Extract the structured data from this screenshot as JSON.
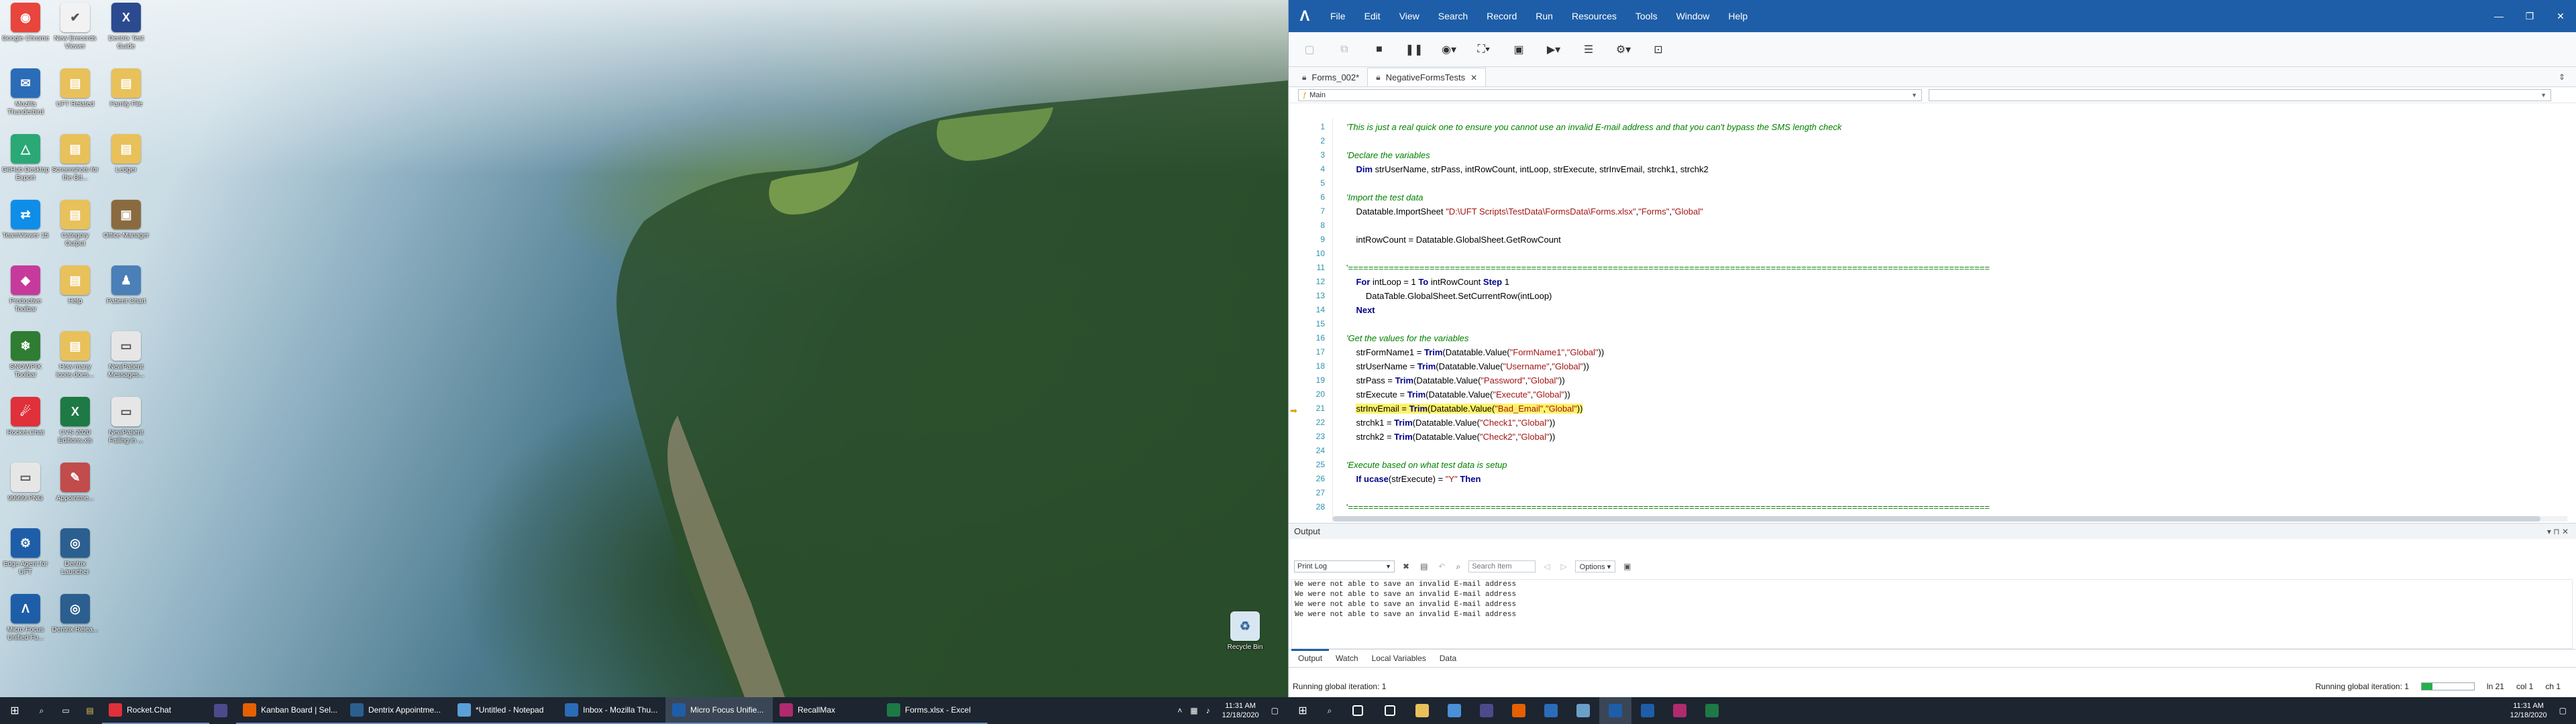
{
  "desktop": {
    "icons_col1": [
      {
        "label": "Google Chrome",
        "color": "#e8453c",
        "glyph": "◉",
        "icon": "chrome-icon"
      },
      {
        "label": "Mozilla Thunderbird",
        "color": "#2b6cb8",
        "glyph": "✉",
        "icon": "thunderbird-icon"
      },
      {
        "label": "GitHub Desktop Export",
        "color": "#2aa876",
        "glyph": "△",
        "icon": "triangle-app-icon"
      },
      {
        "label": "TeamViewer 15",
        "color": "#0e8ee9",
        "glyph": "⇄",
        "icon": "teamviewer-icon"
      },
      {
        "label": "Productive Toolbar",
        "color": "#c63a9b",
        "glyph": "◆",
        "icon": "productive-icon"
      },
      {
        "label": "SNOWPIX Toolbar",
        "color": "#2e7d32",
        "glyph": "❄",
        "icon": "snowpix-icon"
      },
      {
        "label": "Rocket.Chat",
        "color": "#e0303a",
        "glyph": "☄",
        "icon": "rocketchat-icon"
      },
      {
        "label": "99999.PNG",
        "color": "#e6e6e6",
        "glyph": "▭",
        "icon": "png-file-icon"
      },
      {
        "label": "Edge Agent for UFT",
        "color": "#1e5ea8",
        "glyph": "⚙",
        "icon": "edge-agent-icon"
      },
      {
        "label": "Micro Focus Unified Fu...",
        "color": "#1e5ea8",
        "glyph": "Λ",
        "icon": "uft-icon"
      }
    ],
    "icons_col2": [
      {
        "label": "New Erecords Viewer",
        "color": "#f2f2f2",
        "glyph": "✔",
        "icon": "checklist-icon"
      },
      {
        "label": "UFT Related",
        "color": "#e8c15a",
        "glyph": "▤",
        "icon": "folder-icon"
      },
      {
        "label": "Screenshots for the Bd...",
        "color": "#e8c15a",
        "glyph": "▤",
        "icon": "folder-icon"
      },
      {
        "label": "Category Output",
        "color": "#e8c15a",
        "glyph": "▤",
        "icon": "folder-icon"
      },
      {
        "label": "Help",
        "color": "#e8c15a",
        "glyph": "▤",
        "icon": "folder-icon"
      },
      {
        "label": "How many icons does...",
        "color": "#e8c15a",
        "glyph": "▤",
        "icon": "folder-icon"
      },
      {
        "label": "CVS 2020 Editions.xls",
        "color": "#1d7a44",
        "glyph": "X",
        "icon": "excel-file-icon"
      },
      {
        "label": "Appointme...",
        "color": "#c24b4b",
        "glyph": "✎",
        "icon": "appointment-icon"
      },
      {
        "label": "Dentrix Launcher",
        "color": "#2b5f8f",
        "glyph": "◎",
        "icon": "dentrix-launcher-icon"
      },
      {
        "label": "Dentrix Relea...",
        "color": "#2b5f8f",
        "glyph": "◎",
        "icon": "dentrix-release-icon"
      }
    ],
    "icons_col3": [
      {
        "label": "Dentrix Test Guide",
        "color": "#2b4a8f",
        "glyph": "X",
        "icon": "dentrix-x-icon"
      },
      {
        "label": "Family File",
        "color": "#e8c15a",
        "glyph": "▤",
        "icon": "folder-icon"
      },
      {
        "label": "Ledger",
        "color": "#e8c15a",
        "glyph": "▤",
        "icon": "folder-icon"
      },
      {
        "label": "Office Manager",
        "color": "#8a6b3f",
        "glyph": "▣",
        "icon": "office-manager-icon"
      },
      {
        "label": "Patient Chart",
        "color": "#4a7fb8",
        "glyph": "♟",
        "icon": "patient-chart-icon"
      },
      {
        "label": "NewPatient Messages...",
        "color": "#e6e6e6",
        "glyph": "▭",
        "icon": "file-icon"
      },
      {
        "label": "NewPatient Failing in ...",
        "color": "#e6e6e6",
        "glyph": "▭",
        "icon": "file-icon"
      }
    ],
    "recycle_bin": {
      "label": "Recycle Bin",
      "color": "#d8e6f2",
      "glyph": "♻",
      "icon": "recycle-bin-icon"
    }
  },
  "taskbar_left": {
    "start_icon": "windows-start-icon",
    "apps": [
      {
        "label": "Rocket.Chat",
        "color": "#e0303a"
      },
      {
        "label": "",
        "color": "#4d4a8c"
      },
      {
        "label": "Kanban Board | Sel...",
        "color": "#e66000"
      },
      {
        "label": "Dentrix Appointme...",
        "color": "#2b5f8f"
      },
      {
        "label": "*Untitled - Notepad",
        "color": "#5aa0d8"
      },
      {
        "label": "Inbox - Mozilla Thu...",
        "color": "#2b6cb8"
      },
      {
        "label": "Micro Focus Unifie...",
        "color": "#1e5ea8"
      },
      {
        "label": "RecallMax",
        "color": "#b02a6e"
      },
      {
        "label": "Forms.xlsx - Excel",
        "color": "#1d7a44"
      }
    ],
    "clock_time": "11:31 AM",
    "clock_date": "12/18/2020"
  },
  "taskbar_right": {
    "clock_time": "11:31 AM",
    "clock_date": "12/18/2020",
    "pinned_colors": [
      "#ffffff",
      "#ffffff",
      "#e8c15a",
      "#4a8fd8",
      "#4d4a8c",
      "#e66000",
      "#2b6cb8",
      "#6aa0c8",
      "#1e5ea8",
      "#1e5ea8",
      "#b02a6e",
      "#1d7a44"
    ]
  },
  "uft": {
    "menu": [
      "File",
      "Edit",
      "View",
      "Search",
      "Record",
      "Run",
      "Resources",
      "Tools",
      "Window",
      "Help"
    ],
    "tabs": [
      {
        "label": "Forms_002*",
        "active": false
      },
      {
        "label": "NegativeFormsTests",
        "active": true
      }
    ],
    "scope_main": "Main",
    "code_lines": [
      {
        "n": "1",
        "type": "comment",
        "text": "'This is just a real quick one to ensure you cannot use an invalid E-mail address and that you can't bypass the SMS length check"
      },
      {
        "n": "2",
        "type": "blank",
        "text": ""
      },
      {
        "n": "3",
        "type": "comment",
        "text": "'Declare the variables"
      },
      {
        "n": "4",
        "type": "code",
        "text": "    Dim strUserName, strPass, intRowCount, intLoop, strExecute, strInvEmail, strchk1, strchk2"
      },
      {
        "n": "5",
        "type": "blank",
        "text": ""
      },
      {
        "n": "6",
        "type": "comment",
        "text": "'Import the test data"
      },
      {
        "n": "7",
        "type": "code",
        "text": "    Datatable.ImportSheet \"D:\\UFT Scripts\\TestData\\FormsData\\Forms.xlsx\",\"Forms\",\"Global\""
      },
      {
        "n": "8",
        "type": "blank",
        "text": ""
      },
      {
        "n": "9",
        "type": "code",
        "text": "    intRowCount = Datatable.GlobalSheet.GetRowCount"
      },
      {
        "n": "10",
        "type": "blank",
        "text": ""
      },
      {
        "n": "11",
        "type": "sep",
        "text": "'=============================================================================================================================="
      },
      {
        "n": "12",
        "type": "code",
        "text": "    For intLoop = 1 To intRowCount Step 1"
      },
      {
        "n": "13",
        "type": "code",
        "text": "        DataTable.GlobalSheet.SetCurrentRow(intLoop)"
      },
      {
        "n": "14",
        "type": "code",
        "text": "    Next"
      },
      {
        "n": "15",
        "type": "blank",
        "text": ""
      },
      {
        "n": "16",
        "type": "comment",
        "text": "'Get the values for the variables"
      },
      {
        "n": "17",
        "type": "code",
        "text": "    strFormName1 = Trim(Datatable.Value(\"FormName1\",\"Global\"))"
      },
      {
        "n": "18",
        "type": "code",
        "text": "    strUserName = Trim(Datatable.Value(\"Username\",\"Global\"))"
      },
      {
        "n": "19",
        "type": "code",
        "text": "    strPass = Trim(Datatable.Value(\"Password\",\"Global\"))"
      },
      {
        "n": "20",
        "type": "code",
        "text": "    strExecute = Trim(Datatable.Value(\"Execute\",\"Global\"))"
      },
      {
        "n": "21",
        "type": "current",
        "text": "    strInvEmail = Trim(Datatable.Value(\"Bad_Email\",\"Global\"))"
      },
      {
        "n": "22",
        "type": "code",
        "text": "    strchk1 = Trim(Datatable.Value(\"Check1\",\"Global\"))"
      },
      {
        "n": "23",
        "type": "code",
        "text": "    strchk2 = Trim(Datatable.Value(\"Check2\",\"Global\"))"
      },
      {
        "n": "24",
        "type": "blank",
        "text": ""
      },
      {
        "n": "25",
        "type": "comment",
        "text": "'Execute based on what test data is setup"
      },
      {
        "n": "26",
        "type": "code",
        "text": "    If ucase(strExecute) = \"Y\" Then"
      },
      {
        "n": "27",
        "type": "blank",
        "text": ""
      },
      {
        "n": "28",
        "type": "sep",
        "text": "'=============================================================================================================================="
      }
    ],
    "output": {
      "pane_title": "Output",
      "filter": "Print Log",
      "search_placeholder": "Search Item",
      "options_label": "Options",
      "lines": [
        "We were not able to save an invalid E-mail address",
        "We were not able to save an invalid E-mail address",
        "We were not able to save an invalid E-mail address",
        "We were not able to save an invalid E-mail address"
      ]
    },
    "bottom_tabs": [
      "Output",
      "Watch",
      "Local Variables",
      "Data"
    ],
    "status": {
      "left": "Running global iteration: 1",
      "right": "Running global iteration: 1",
      "progress": 0.2,
      "ln": "ln 21",
      "col": "col 1",
      "ch": "ch 1"
    }
  }
}
